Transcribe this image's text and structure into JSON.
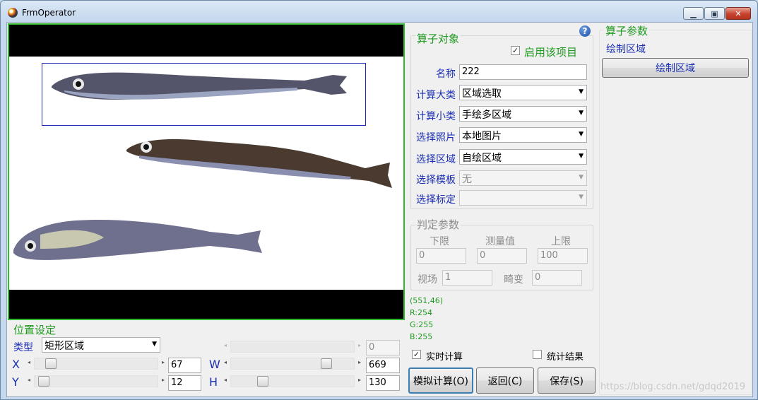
{
  "window": {
    "title": "FrmOperator",
    "buttons": [
      "minimize",
      "maximize",
      "close"
    ]
  },
  "operator_object": {
    "title": "算子对象",
    "enable_label": "启用该项目",
    "enable_checked": true,
    "name_label": "名称",
    "name_value": "222",
    "calc_category_label": "计算大类",
    "calc_category_value": "区域选取",
    "calc_subclass_label": "计算小类",
    "calc_subclass_value": "手绘多区域",
    "select_photo_label": "选择照片",
    "select_photo_value": "本地图片",
    "select_region_label": "选择区域",
    "select_region_value": "自绘区域",
    "select_template_label": "选择模板",
    "select_template_value": "无",
    "select_calibration_label": "选择标定",
    "select_calibration_value": ""
  },
  "judge_params": {
    "title": "判定参数",
    "lower_label": "下限",
    "lower_value": "0",
    "measure_label": "测量值",
    "measure_value": "0",
    "upper_label": "上限",
    "upper_value": "100",
    "fov_label": "视场",
    "fov_value": "1",
    "distortion_label": "畸变",
    "distortion_value": "0"
  },
  "pixel_info": {
    "coord": "(551,46)",
    "r": "R:254",
    "g": "G:255",
    "b": "B:255"
  },
  "position_settings": {
    "title": "位置设定",
    "type_label": "类型",
    "type_value": "矩形区域",
    "top_value": "0",
    "x_label": "X",
    "x_value": "67",
    "y_label": "Y",
    "y_value": "12",
    "w_label": "W",
    "w_value": "669",
    "h_label": "H",
    "h_value": "130"
  },
  "options": {
    "realtime_label": "实时计算",
    "realtime_checked": true,
    "stats_label": "统计结果",
    "stats_checked": false
  },
  "buttons": {
    "simulate": "模拟计算(O)",
    "back": "返回(C)",
    "save": "保存(S)"
  },
  "operator_params": {
    "title": "算子参数",
    "draw_area_label": "绘制区域",
    "draw_area_button": "绘制区域"
  },
  "watermark": "https://blog.csdn.net/gdqd2019",
  "colors": {
    "accent_green": "#219a21",
    "label_blue": "#1b2fb3",
    "image_border": "#32b932"
  }
}
